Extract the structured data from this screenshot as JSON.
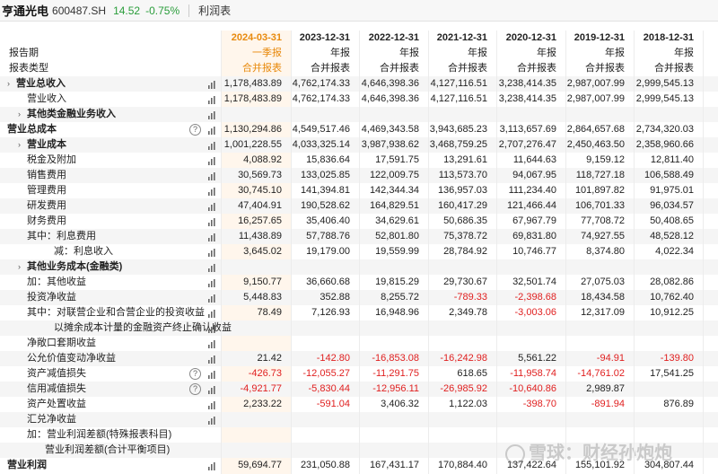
{
  "stock": {
    "name": "亨通光电",
    "code": "600487.SH",
    "price": "14.52",
    "change": "-0.75%",
    "tab": "利润表"
  },
  "header": {
    "row1_label": "报告期",
    "row2_label": "报表类型",
    "dates": [
      "2024-03-31",
      "2023-12-31",
      "2022-12-31",
      "2021-12-31",
      "2020-12-31",
      "2019-12-31",
      "2018-12-31",
      "2"
    ],
    "period_types": [
      "一季报",
      "年报",
      "年报",
      "年报",
      "年报",
      "年报",
      "年报",
      ""
    ],
    "statement_kinds": [
      "合并报表",
      "合并报表",
      "合并报表",
      "合并报表",
      "合并报表",
      "合并报表",
      "合并报表",
      ""
    ]
  },
  "rows": [
    {
      "label": "营业总收入",
      "bold": true,
      "chev": "›",
      "indent": "l1",
      "bar": true,
      "values": [
        "1,178,483.89",
        "4,762,174.33",
        "4,646,398.36",
        "4,127,116.51",
        "3,238,414.35",
        "2,987,007.99",
        "2,999,545.13",
        "2,4"
      ]
    },
    {
      "label": "营业收入",
      "indent": "l2",
      "bar": true,
      "values": [
        "1,178,483.89",
        "4,762,174.33",
        "4,646,398.36",
        "4,127,116.51",
        "3,238,414.35",
        "2,987,007.99",
        "2,999,545.13",
        "2,4"
      ]
    },
    {
      "label": "其他类金融业务收入",
      "bold": true,
      "chev": "›",
      "indent": "l2c",
      "bar": true,
      "values": [
        "",
        "",
        "",
        "",
        "",
        "",
        "",
        ""
      ]
    },
    {
      "label": "营业总成本",
      "bold": true,
      "indent": "l0",
      "help": true,
      "bar": true,
      "values": [
        "1,130,294.86",
        "4,549,517.46",
        "4,469,343.58",
        "3,943,685.23",
        "3,113,657.69",
        "2,864,657.68",
        "2,734,320.03",
        "2,"
      ]
    },
    {
      "label": "营业成本",
      "bold": true,
      "chev": "›",
      "indent": "l2c",
      "bar": true,
      "values": [
        "1,001,228.55",
        "4,033,325.14",
        "3,987,938.62",
        "3,468,759.25",
        "2,707,276.47",
        "2,450,463.50",
        "2,358,960.66",
        "1,"
      ]
    },
    {
      "label": "税金及附加",
      "indent": "l2",
      "bar": true,
      "values": [
        "4,088.92",
        "15,836.64",
        "17,591.75",
        "13,291.61",
        "11,644.63",
        "9,159.12",
        "12,811.40",
        ""
      ]
    },
    {
      "label": "销售费用",
      "indent": "l2",
      "bar": true,
      "values": [
        "30,569.73",
        "133,025.85",
        "122,009.75",
        "113,573.70",
        "94,067.95",
        "118,727.18",
        "106,588.49",
        ""
      ]
    },
    {
      "label": "管理费用",
      "indent": "l2",
      "bar": true,
      "values": [
        "30,745.10",
        "141,394.81",
        "142,344.34",
        "136,957.03",
        "111,234.40",
        "101,897.82",
        "91,975.01",
        ""
      ]
    },
    {
      "label": "研发费用",
      "indent": "l2",
      "bar": true,
      "values": [
        "47,404.91",
        "190,528.62",
        "164,829.51",
        "160,417.29",
        "121,466.44",
        "106,701.33",
        "96,034.57",
        ""
      ]
    },
    {
      "label": "财务费用",
      "indent": "l2",
      "bar": true,
      "values": [
        "16,257.65",
        "35,406.40",
        "34,629.61",
        "50,686.35",
        "67,967.79",
        "77,708.72",
        "50,408.65",
        ""
      ]
    },
    {
      "label": "其中：利息费用",
      "indent": "l2",
      "bar": true,
      "values": [
        "11,438.89",
        "57,788.76",
        "52,801.80",
        "75,378.72",
        "69,831.80",
        "74,927.55",
        "48,528.12",
        ""
      ]
    },
    {
      "label": "减：利息收入",
      "indent": "l3",
      "bar": true,
      "values": [
        "3,645.02",
        "19,179.00",
        "19,559.99",
        "28,784.92",
        "10,746.77",
        "8,374.80",
        "4,022.34",
        ""
      ]
    },
    {
      "label": "其他业务成本(金融类)",
      "bold": true,
      "chev": "›",
      "indent": "l2c",
      "bar": true,
      "values": [
        "",
        "",
        "",
        "",
        "",
        "",
        "",
        ""
      ]
    },
    {
      "label": "加：其他收益",
      "indent": "l2",
      "bar": true,
      "values": [
        "9,150.77",
        "36,660.68",
        "19,815.29",
        "29,730.67",
        "32,501.74",
        "27,075.03",
        "28,082.86",
        ""
      ]
    },
    {
      "label": "投资净收益",
      "indent": "l2",
      "bar": true,
      "values": [
        "5,448.83",
        "352.88",
        "8,255.72",
        "-789.33",
        "-2,398.68",
        "18,434.58",
        "10,762.40",
        ""
      ]
    },
    {
      "label": "其中：对联营企业和合营企业的投资收益",
      "indent": "l2",
      "bar": true,
      "values": [
        "78.49",
        "7,126.93",
        "16,948.96",
        "2,349.78",
        "-3,003.06",
        "12,317.09",
        "10,912.25",
        ""
      ]
    },
    {
      "label": "以摊余成本计量的金融资产终止确认收益",
      "indent": "l4",
      "bar": true,
      "values": [
        "",
        "",
        "",
        "",
        "",
        "",
        "",
        ""
      ]
    },
    {
      "label": "净敞口套期收益",
      "indent": "l2",
      "bar": true,
      "values": [
        "",
        "",
        "",
        "",
        "",
        "",
        "",
        ""
      ]
    },
    {
      "label": "公允价值变动净收益",
      "indent": "l2",
      "bar": true,
      "values": [
        "21.42",
        "-142.80",
        "-16,853.08",
        "-16,242.98",
        "5,561.22",
        "-94.91",
        "-139.80",
        ""
      ]
    },
    {
      "label": "资产减值损失",
      "indent": "l2",
      "help": true,
      "bar": true,
      "values": [
        "-426.73",
        "-12,055.27",
        "-11,291.75",
        "618.65",
        "-11,958.74",
        "-14,761.02",
        "17,541.25",
        ""
      ]
    },
    {
      "label": "信用减值损失",
      "indent": "l2",
      "help": true,
      "bar": true,
      "values": [
        "-4,921.77",
        "-5,830.44",
        "-12,956.11",
        "-26,985.92",
        "-10,640.86",
        "2,989.87",
        "",
        ""
      ]
    },
    {
      "label": "资产处置收益",
      "indent": "l2",
      "bar": true,
      "values": [
        "2,233.22",
        "-591.04",
        "3,406.32",
        "1,122.03",
        "-398.70",
        "-891.94",
        "876.89",
        ""
      ]
    },
    {
      "label": "汇兑净收益",
      "indent": "l2",
      "bar": true,
      "values": [
        "",
        "",
        "",
        "",
        "",
        "",
        "",
        ""
      ]
    },
    {
      "label": "加：营业利润差额(特殊报表科目)",
      "indent": "l2",
      "bar": false,
      "values": [
        "",
        "",
        "",
        "",
        "",
        "",
        "",
        ""
      ]
    },
    {
      "label": "营业利润差额(合计平衡项目)",
      "indent": "l3b",
      "bar": false,
      "values": [
        "",
        "",
        "",
        "",
        "",
        "",
        "",
        ""
      ]
    },
    {
      "label": "营业利润",
      "bold": true,
      "indent": "l0",
      "bar": true,
      "values": [
        "59,694.77",
        "231,050.88",
        "167,431.17",
        "170,884.40",
        "137,422.64",
        "155,101.92",
        "304,807.44",
        "2"
      ]
    }
  ],
  "watermark": "雪球：财经孙炮炮",
  "colors": {
    "highlight_col": "#fff6ec",
    "orange": "#e8890c",
    "negative": "#e02020",
    "up_down": "#2a9d3b"
  }
}
